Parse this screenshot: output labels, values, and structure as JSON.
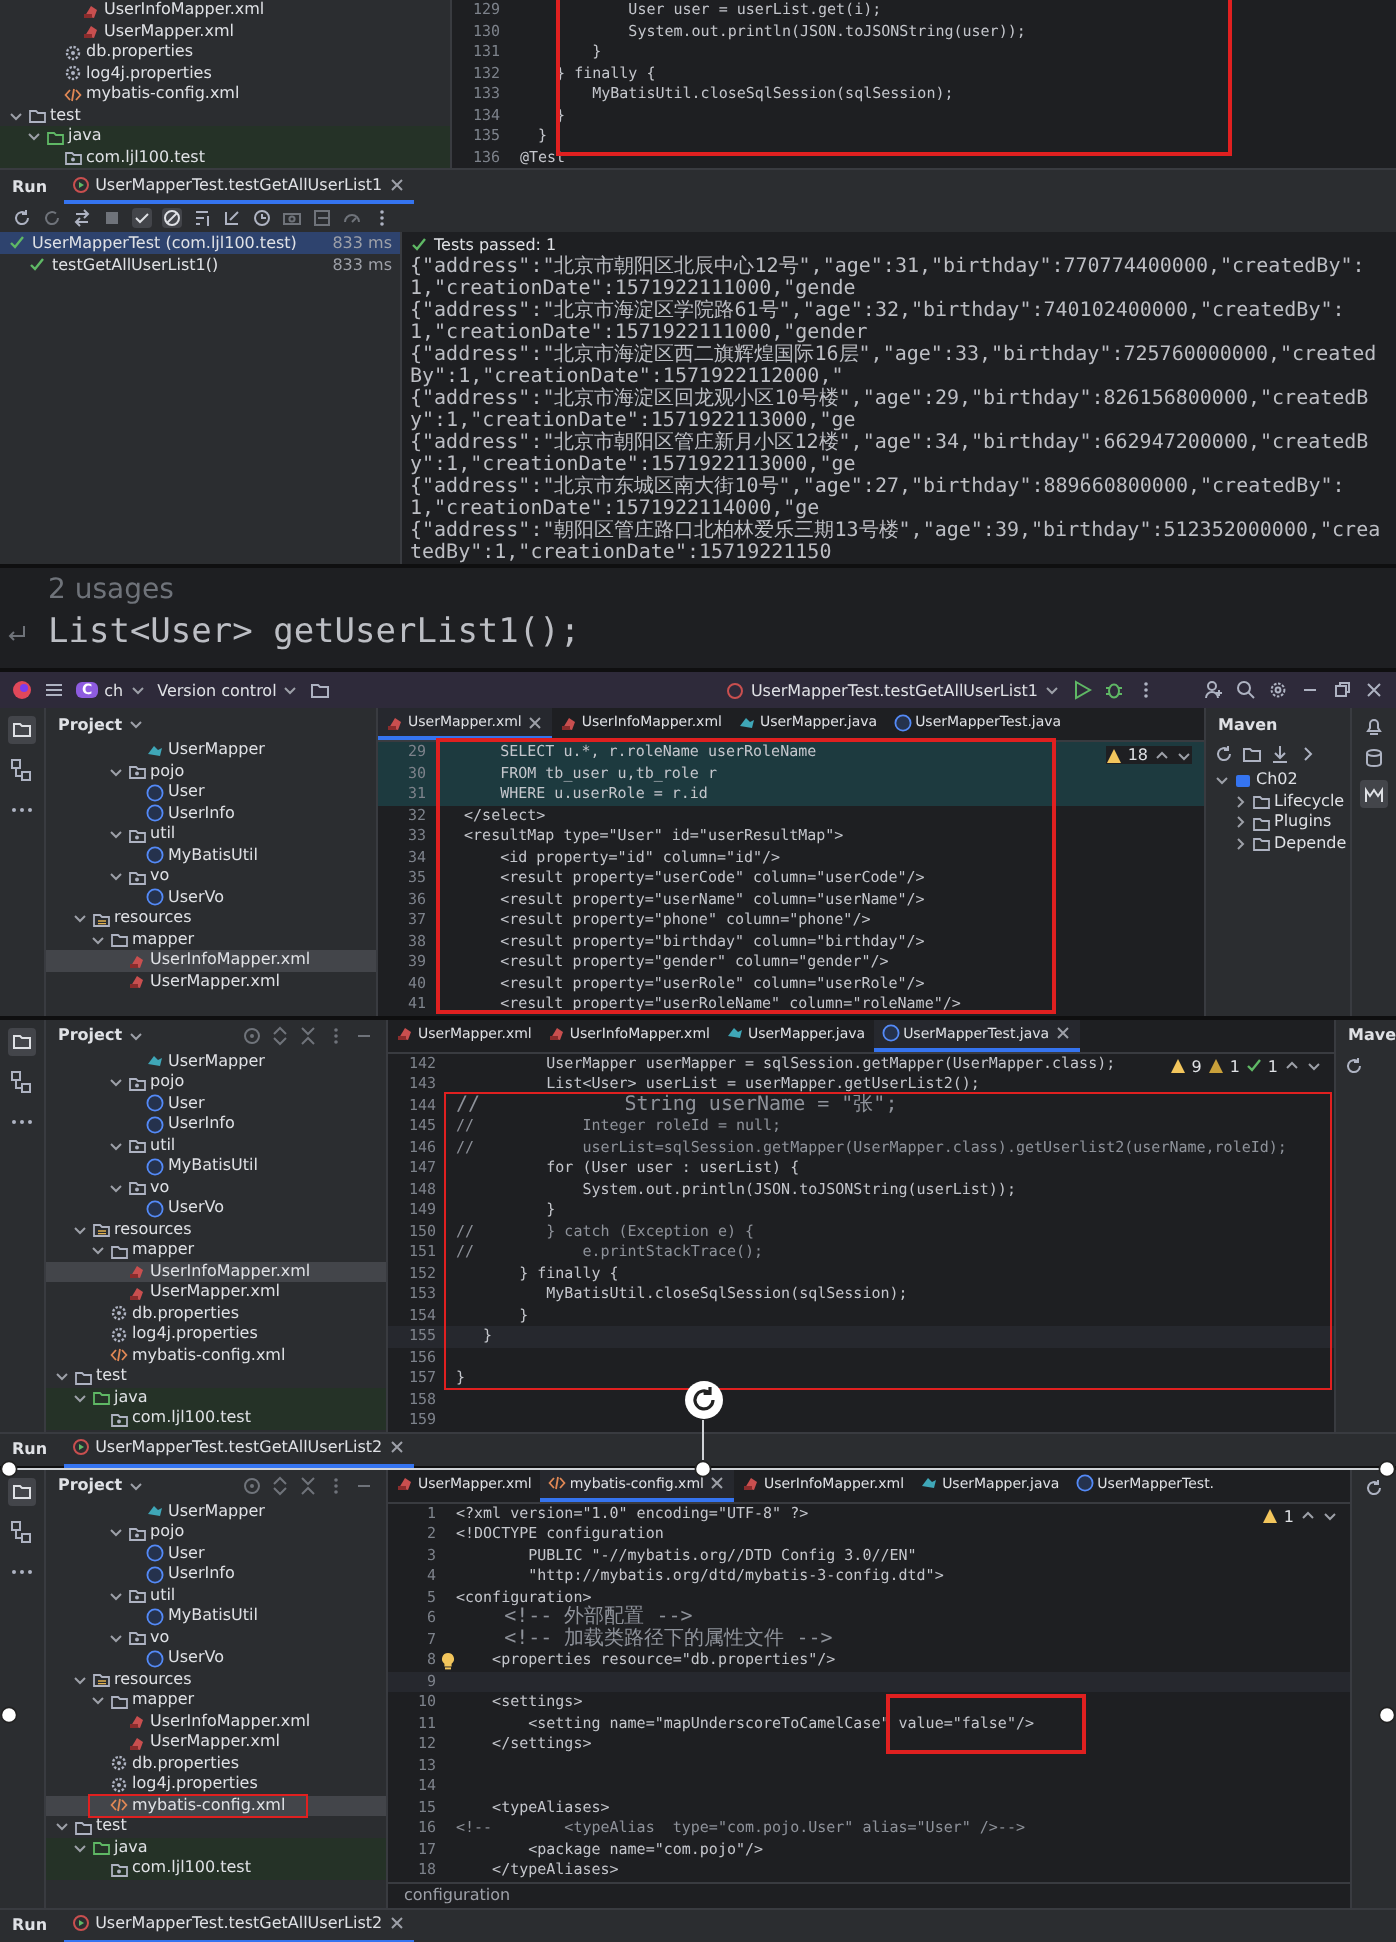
{
  "run_view": {
    "tree": [
      {
        "children": [
          {
            "children": [
              {
                "children": [
                  {
                    "label": "UserInfoMapper.xml",
                    "kind": "mapper-xml",
                    "selected": false
                  },
                  {
                    "label": "UserMapper.xml",
                    "kind": "mapper-xml",
                    "selected": false
                  }
                ]
              },
              {
                "label": "db.properties",
                "kind": "properties",
                "selected": false
              },
              {
                "label": "log4j.properties",
                "kind": "properties",
                "selected": false
              },
              {
                "label": "mybatis-config.xml",
                "kind": "xml",
                "selected": false
              }
            ]
          }
        ]
      },
      {
        "label": "test",
        "kind": "folder",
        "expanded": true,
        "selected": false,
        "children": [
          {
            "label": "java",
            "kind": "test-root",
            "expanded": true,
            "selected": false,
            "children": [
              {
                "label": "com.ljl100.test",
                "kind": "package",
                "selected": false
              }
            ]
          }
        ]
      }
    ],
    "code_lines": [
      {
        "number": "129",
        "text": "            User user = userList.get(i);",
        "kind": "code"
      },
      {
        "number": "130",
        "text": "            System.out.println(JSON.toJSONString(user));",
        "kind": "code"
      },
      {
        "number": "131",
        "text": "        }",
        "kind": "code"
      },
      {
        "number": "132",
        "text": "    } finally {",
        "kind": "code"
      },
      {
        "number": "133",
        "text": "        MyBatisUtil.closeSqlSession(sqlSession);",
        "kind": "code"
      },
      {
        "number": "134",
        "text": "    }",
        "kind": "code"
      },
      {
        "number": "135",
        "text": "  }",
        "kind": "code"
      },
      {
        "number": "136",
        "text": "@Test",
        "kind": "code"
      }
    ],
    "run_tab": {
      "label": "Run",
      "title": "UserMapperTest.testGetAllUserList1"
    },
    "test_results": [
      {
        "label": "UserMapperTest (com.ljl100.test)",
        "duration": "833 ms",
        "passed": true,
        "selected": true,
        "children": [
          {
            "label": "testGetAllUserList1()",
            "duration": "833 ms",
            "passed": true,
            "selected": false
          }
        ]
      }
    ],
    "status": "Tests passed: 1",
    "output_lines": [
      "{\"address\":\"北京市朝阳区北辰中心12号\",\"age\":31,\"birthday\":770774400000,\"createdBy\":1,\"creationDate\":1571922111000,\"gende",
      "{\"address\":\"北京市海淀区学院路61号\",\"age\":32,\"birthday\":740102400000,\"createdBy\":1,\"creationDate\":1571922111000,\"gender",
      "{\"address\":\"北京市海淀区西二旗辉煌国际16层\",\"age\":33,\"birthday\":725760000000,\"createdBy\":1,\"creationDate\":1571922112000,\"",
      "{\"address\":\"北京市海淀区回龙观小区10号楼\",\"age\":29,\"birthday\":826156800000,\"createdBy\":1,\"creationDate\":1571922113000,\"ge",
      "{\"address\":\"北京市朝阳区管庄新月小区12楼\",\"age\":34,\"birthday\":662947200000,\"createdBy\":1,\"creationDate\":1571922113000,\"ge",
      "{\"address\":\"北京市东城区南大街10号\",\"age\":27,\"birthday\":889660800000,\"createdBy\":1,\"creationDate\":1571922114000,\"ge",
      "{\"address\":\"朝阳区管庄路口北柏林爱乐三期13号楼\",\"age\":39,\"birthday\":512352000000,\"createdBy\":1,\"creationDate\":15719221150"
    ]
  },
  "usage_view": {
    "usages": "2 usages",
    "code": "List<User> getUserList1();"
  },
  "mapper_view": {
    "title_bar": {
      "project_badge": "C",
      "project": "ch",
      "vcs": "Version control",
      "run_config": "UserMapperTest.testGetAllUserList1"
    },
    "sidebar_title": "Project",
    "tabs": [
      {
        "label": "UserMapper.xml",
        "kind": "mapper-xml",
        "selected": true
      },
      {
        "label": "UserInfoMapper.xml",
        "kind": "mapper-xml",
        "selected": false
      },
      {
        "label": "UserMapper.java",
        "kind": "interface",
        "selected": false
      },
      {
        "label": "UserMapperTest.java",
        "kind": "class",
        "selected": false
      }
    ],
    "warnings": "18",
    "tree": [
      {
        "children": [
          {
            "children": [
              {
                "children": [
                  {
                    "children": [
                      {
                        "label": "UserMapper",
                        "kind": "interface",
                        "selected": false
                      }
                    ]
                  },
                  {
                    "label": "pojo",
                    "kind": "package",
                    "expanded": true,
                    "selected": false,
                    "children": [
                      {
                        "label": "User",
                        "kind": "class",
                        "selected": false
                      },
                      {
                        "label": "UserInfo",
                        "kind": "class",
                        "selected": false
                      }
                    ]
                  },
                  {
                    "label": "util",
                    "kind": "package",
                    "expanded": true,
                    "selected": false,
                    "children": [
                      {
                        "label": "MyBatisUtil",
                        "kind": "class",
                        "selected": false
                      }
                    ]
                  },
                  {
                    "label": "vo",
                    "kind": "package",
                    "expanded": true,
                    "selected": false,
                    "children": [
                      {
                        "label": "UserVo",
                        "kind": "class",
                        "selected": false
                      }
                    ]
                  }
                ]
              }
            ]
          },
          {
            "label": "resources",
            "kind": "resources",
            "expanded": true,
            "selected": false,
            "children": [
              {
                "label": "mapper",
                "kind": "folder",
                "expanded": true,
                "selected": false,
                "children": [
                  {
                    "label": "UserInfoMapper.xml",
                    "kind": "mapper-xml",
                    "selected": true
                  },
                  {
                    "label": "UserMapper.xml",
                    "kind": "mapper-xml",
                    "selected": false
                  }
                ]
              }
            ]
          }
        ]
      }
    ],
    "code_lines": [
      {
        "number": "29",
        "text": "      SELECT u.*, r.roleName userRoleName",
        "kind": "highlight"
      },
      {
        "number": "30",
        "text": "      FROM tb_user u,tb_role r",
        "kind": "highlight"
      },
      {
        "number": "31",
        "text": "      WHERE u.userRole = r.id",
        "kind": "highlight"
      },
      {
        "number": "32",
        "text": "  </select>",
        "kind": "code"
      },
      {
        "number": "33",
        "text": "  <resultMap type=\"User\" id=\"userResultMap\">",
        "kind": "code"
      },
      {
        "number": "34",
        "text": "      <id property=\"id\" column=\"id\"/>",
        "kind": "code"
      },
      {
        "number": "35",
        "text": "      <result property=\"userCode\" column=\"userCode\"/>",
        "kind": "code"
      },
      {
        "number": "36",
        "text": "      <result property=\"userName\" column=\"userName\"/>",
        "kind": "code"
      },
      {
        "number": "37",
        "text": "      <result property=\"phone\" column=\"phone\"/>",
        "kind": "code"
      },
      {
        "number": "38",
        "text": "      <result property=\"birthday\" column=\"birthday\"/>",
        "kind": "code"
      },
      {
        "number": "39",
        "text": "      <result property=\"gender\" column=\"gender\"/>",
        "kind": "code"
      },
      {
        "number": "40",
        "text": "      <result property=\"userRole\" column=\"userRole\"/>",
        "kind": "code"
      },
      {
        "number": "41",
        "text": "      <result property=\"userRoleName\" column=\"roleName\"/>",
        "kind": "code"
      }
    ],
    "maven": {
      "title": "Maven",
      "tree": [
        {
          "label": "Ch02",
          "kind": "maven-project",
          "expanded": true,
          "selected": false,
          "children": [
            {
              "label": "Lifecycle",
              "kind": "folder",
              "expanded": false,
              "selected": false
            },
            {
              "label": "Plugins",
              "kind": "folder",
              "expanded": false,
              "selected": false
            },
            {
              "label": "Depende",
              "kind": "folder",
              "expanded": false,
              "selected": false
            }
          ]
        }
      ]
    }
  },
  "test_view": {
    "sidebar_title": "Project",
    "tabs": [
      {
        "label": "UserMapper.xml",
        "kind": "mapper-xml",
        "selected": false
      },
      {
        "label": "UserInfoMapper.xml",
        "kind": "mapper-xml",
        "selected": false
      },
      {
        "label": "UserMapper.java",
        "kind": "interface",
        "selected": false
      },
      {
        "label": "UserMapperTest.java",
        "kind": "class",
        "selected": true
      }
    ],
    "inspections": [
      {
        "kind": "warning",
        "count": "9"
      },
      {
        "kind": "weak-warning",
        "count": "1"
      },
      {
        "kind": "ok",
        "count": "1"
      }
    ],
    "tree": [
      {
        "children": [
          {
            "children": [
              {
                "children": [
                  {
                    "children": [
                      {
                        "label": "UserMapper",
                        "kind": "interface",
                        "selected": false
                      }
                    ]
                  },
                  {
                    "label": "pojo",
                    "kind": "package",
                    "expanded": true,
                    "selected": false,
                    "children": [
                      {
                        "label": "User",
                        "kind": "class",
                        "selected": false
                      },
                      {
                        "label": "UserInfo",
                        "kind": "class",
                        "selected": false
                      }
                    ]
                  },
                  {
                    "label": "util",
                    "kind": "package",
                    "expanded": true,
                    "selected": false,
                    "children": [
                      {
                        "label": "MyBatisUtil",
                        "kind": "class",
                        "selected": false
                      }
                    ]
                  },
                  {
                    "label": "vo",
                    "kind": "package",
                    "expanded": true,
                    "selected": false,
                    "children": [
                      {
                        "label": "UserVo",
                        "kind": "class",
                        "selected": false
                      }
                    ]
                  }
                ]
              }
            ]
          },
          {
            "label": "resources",
            "kind": "resources",
            "expanded": true,
            "selected": false,
            "children": [
              {
                "label": "mapper",
                "kind": "folder",
                "expanded": true,
                "selected": false,
                "children": [
                  {
                    "label": "UserInfoMapper.xml",
                    "kind": "mapper-xml",
                    "selected": true
                  },
                  {
                    "label": "UserMapper.xml",
                    "kind": "mapper-xml",
                    "selected": false
                  }
                ]
              },
              {
                "label": "db.properties",
                "kind": "properties",
                "selected": false
              },
              {
                "label": "log4j.properties",
                "kind": "properties",
                "selected": false
              },
              {
                "label": "mybatis-config.xml",
                "kind": "xml",
                "selected": false
              }
            ]
          }
        ]
      },
      {
        "label": "test",
        "kind": "folder",
        "expanded": true,
        "selected": false,
        "children": [
          {
            "label": "java",
            "kind": "test-root",
            "expanded": true,
            "selected": false,
            "children": [
              {
                "label": "com.ljl100.test",
                "kind": "package",
                "selected": false
              }
            ]
          }
        ]
      }
    ],
    "code_lines": [
      {
        "number": "142",
        "text": "          UserMapper userMapper = sqlSession.getMapper(UserMapper.class);",
        "kind": "code"
      },
      {
        "number": "143",
        "text": "          List<User> userList = userMapper.getUserList2();",
        "kind": "code"
      },
      {
        "number": "144",
        "text": "//            String userName = \"张\";",
        "kind": "comment"
      },
      {
        "number": "145",
        "text": "//            Integer roleId = null;",
        "kind": "comment"
      },
      {
        "number": "146",
        "text": "//            userList=sqlSession.getMapper(UserMapper.class).getUserlist2(userName,roleId);",
        "kind": "comment"
      },
      {
        "number": "147",
        "text": "          for (User user : userList) {",
        "kind": "code"
      },
      {
        "number": "148",
        "text": "              System.out.println(JSON.toJSONString(userList));",
        "kind": "code"
      },
      {
        "number": "149",
        "text": "          }",
        "kind": "code"
      },
      {
        "number": "150",
        "text": "//        } catch (Exception e) {",
        "kind": "comment"
      },
      {
        "number": "151",
        "text": "//            e.printStackTrace();",
        "kind": "comment"
      },
      {
        "number": "152",
        "text": "       } finally {",
        "kind": "code"
      },
      {
        "number": "153",
        "text": "          MyBatisUtil.closeSqlSession(sqlSession);",
        "kind": "code"
      },
      {
        "number": "154",
        "text": "       }",
        "kind": "code"
      },
      {
        "number": "155",
        "text": "   }",
        "kind": "current"
      },
      {
        "number": "156",
        "kind": "code"
      },
      {
        "number": "157",
        "text": "}",
        "kind": "code"
      },
      {
        "number": "158",
        "kind": "code"
      },
      {
        "number": "159",
        "kind": "code"
      }
    ],
    "maven": {
      "title": "Mave"
    },
    "run_tab": {
      "label": "Run",
      "title": "UserMapperTest.testGetAllUserList2"
    }
  },
  "config_view": {
    "sidebar_title": "Project",
    "tabs": [
      {
        "label": "UserMapper.xml",
        "kind": "mapper-xml",
        "selected": false
      },
      {
        "label": "mybatis-config.xml",
        "kind": "xml",
        "selected": true
      },
      {
        "label": "UserInfoMapper.xml",
        "kind": "mapper-xml",
        "selected": false
      },
      {
        "label": "UserMapper.java",
        "kind": "interface",
        "selected": false
      },
      {
        "label": "UserMapperTest.",
        "kind": "class",
        "selected": false
      }
    ],
    "warnings": "1",
    "tree": [
      {
        "children": [
          {
            "children": [
              {
                "children": [
                  {
                    "children": [
                      {
                        "label": "UserMapper",
                        "kind": "interface",
                        "selected": false
                      }
                    ]
                  },
                  {
                    "label": "pojo",
                    "kind": "package",
                    "expanded": true,
                    "selected": false,
                    "children": [
                      {
                        "label": "User",
                        "kind": "class",
                        "selected": false
                      },
                      {
                        "label": "UserInfo",
                        "kind": "class",
                        "selected": false
                      }
                    ]
                  },
                  {
                    "label": "util",
                    "kind": "package",
                    "expanded": true,
                    "selected": false,
                    "children": [
                      {
                        "label": "MyBatisUtil",
                        "kind": "class",
                        "selected": false
                      }
                    ]
                  },
                  {
                    "label": "vo",
                    "kind": "package",
                    "expanded": true,
                    "selected": false,
                    "children": [
                      {
                        "label": "UserVo",
                        "kind": "class",
                        "selected": false
                      }
                    ]
                  }
                ]
              }
            ]
          },
          {
            "label": "resources",
            "kind": "resources",
            "expanded": true,
            "selected": false,
            "children": [
              {
                "label": "mapper",
                "kind": "folder",
                "expanded": true,
                "selected": false,
                "children": [
                  {
                    "label": "UserInfoMapper.xml",
                    "kind": "mapper-xml",
                    "selected": false
                  },
                  {
                    "label": "UserMapper.xml",
                    "kind": "mapper-xml",
                    "selected": false
                  }
                ]
              },
              {
                "label": "db.properties",
                "kind": "properties",
                "selected": false
              },
              {
                "label": "log4j.properties",
                "kind": "properties",
                "selected": false
              },
              {
                "label": "mybatis-config.xml",
                "kind": "xml",
                "selected": true
              }
            ]
          }
        ]
      },
      {
        "label": "test",
        "kind": "folder",
        "expanded": true,
        "selected": false,
        "children": [
          {
            "label": "java",
            "kind": "test-root",
            "expanded": true,
            "selected": false,
            "children": [
              {
                "label": "com.ljl100.test",
                "kind": "package",
                "selected": false
              }
            ]
          }
        ]
      }
    ],
    "code_lines": [
      {
        "number": "1",
        "text": "<?xml version=\"1.0\" encoding=\"UTF-8\" ?>",
        "kind": "code"
      },
      {
        "number": "2",
        "text": "<!DOCTYPE configuration",
        "kind": "code"
      },
      {
        "number": "3",
        "text": "        PUBLIC \"-//mybatis.org//DTD Config 3.0//EN\"",
        "kind": "code"
      },
      {
        "number": "4",
        "text": "        \"http://mybatis.org/dtd/mybatis-3-config.dtd\">",
        "kind": "code"
      },
      {
        "number": "5",
        "text": "<configuration>",
        "kind": "code"
      },
      {
        "number": "6",
        "text": "    <!-- 外部配置 -->",
        "kind": "comment"
      },
      {
        "number": "7",
        "text": "    <!-- 加载类路径下的属性文件 -->",
        "kind": "comment"
      },
      {
        "number": "8",
        "text": "    <properties resource=\"db.properties\"/>",
        "kind": "intention"
      },
      {
        "number": "9",
        "kind": "current"
      },
      {
        "number": "10",
        "text": "    <settings>",
        "kind": "code"
      },
      {
        "number": "11",
        "text": "        <setting name=\"mapUnderscoreToCamelCase\" value=\"false\"/>",
        "kind": "code"
      },
      {
        "number": "12",
        "text": "    </settings>",
        "kind": "code"
      },
      {
        "number": "13",
        "kind": "code"
      },
      {
        "number": "14",
        "kind": "code"
      },
      {
        "number": "15",
        "text": "    <typeAliases>",
        "kind": "code"
      },
      {
        "number": "16",
        "text": "<!--        <typeAlias  type=\"com.pojo.User\" alias=\"User\" />-->",
        "kind": "comment"
      },
      {
        "number": "17",
        "text": "        <package name=\"com.pojo\"/>",
        "kind": "code"
      },
      {
        "number": "18",
        "text": "    </typeAliases>",
        "kind": "code"
      }
    ],
    "breadcrumb": "configuration",
    "run_tab": {
      "label": "Run",
      "title": "UserMapperTest.testGetAllUserList2"
    }
  }
}
